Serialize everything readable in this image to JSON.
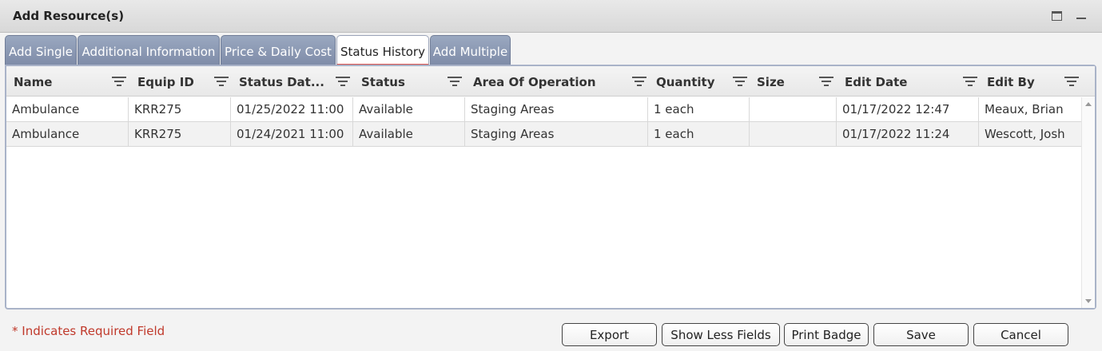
{
  "window": {
    "title": "Add Resource(s)"
  },
  "tabs": [
    {
      "label": "Add Single"
    },
    {
      "label": "Additional Information"
    },
    {
      "label": "Price & Daily Cost"
    },
    {
      "label": "Status History"
    },
    {
      "label": "Add Multiple"
    }
  ],
  "active_tab": "Status History",
  "grid": {
    "columns": [
      {
        "label": "Name"
      },
      {
        "label": "Equip ID"
      },
      {
        "label": "Status Dat..."
      },
      {
        "label": "Status"
      },
      {
        "label": "Area Of Operation"
      },
      {
        "label": "Quantity"
      },
      {
        "label": "Size"
      },
      {
        "label": "Edit Date"
      },
      {
        "label": "Edit By"
      }
    ],
    "rows": [
      {
        "cells": [
          "Ambulance",
          "KRR275",
          "01/25/2022 11:00",
          "Available",
          "Staging Areas",
          "1 each",
          "",
          "01/17/2022 12:47",
          "Meaux, Brian"
        ]
      },
      {
        "cells": [
          "Ambulance",
          "KRR275",
          "01/24/2021 11:00",
          "Available",
          "Staging Areas",
          "1 each",
          "",
          "01/17/2022 11:24",
          "Wescott, Josh"
        ]
      }
    ]
  },
  "footer": {
    "required_note": "* Indicates Required Field",
    "buttons": {
      "export": "Export",
      "show_less_fields": "Show Less Fields",
      "print_badge": "Print Badge",
      "save": "Save",
      "cancel": "Cancel"
    }
  },
  "colors": {
    "tab_inactive": "#8b97b2",
    "active_tab_underline": "#d9534f",
    "required_text": "#c0392b"
  }
}
